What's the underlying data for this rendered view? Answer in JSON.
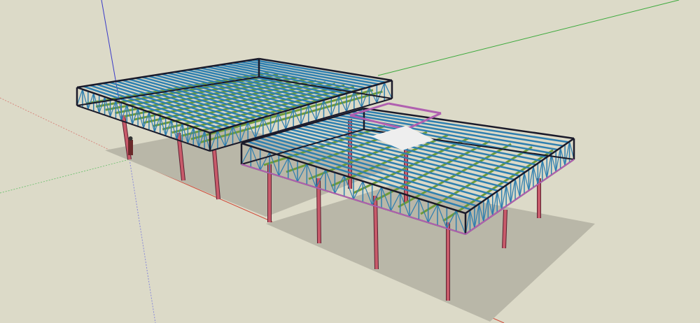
{
  "viewport": {
    "background": "#dcdac8",
    "colors": {
      "column": "#c85a6a",
      "purlin": "#2e7fb0",
      "joist": "#6f9a3a",
      "outline": "#1a1a2a",
      "rim": "#b060b0",
      "shadow": "#b9b7a8",
      "axis_red": "#d04a3a",
      "axis_green": "#3caa3c",
      "axis_blue": "#3a3ac8"
    }
  }
}
